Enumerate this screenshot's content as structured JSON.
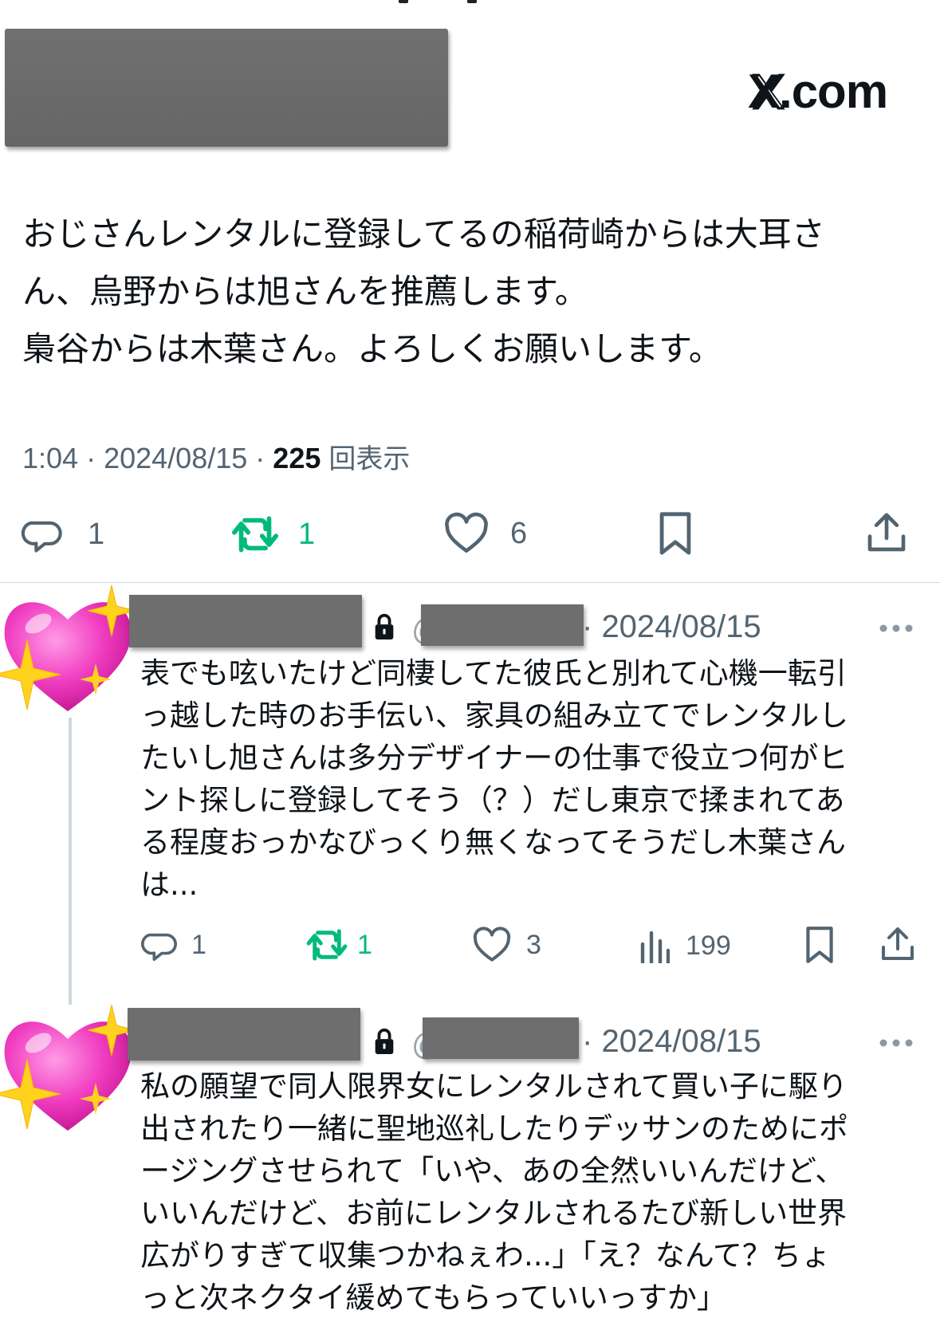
{
  "header": {
    "site_label": "X.com"
  },
  "tweet": {
    "text_lines": [
      "おじさんレンタルに登録してるの稲荷崎からは大耳さ",
      "ん、烏野からは旭さんを推薦します。",
      "梟谷からは木葉さん。よろしくお願いします。"
    ],
    "time": "1:04",
    "date": "2024/08/15",
    "views_count": "225",
    "views_label": "回表示",
    "replies": "1",
    "reposts": "1",
    "likes": "6"
  },
  "replies": [
    {
      "date": "2024/08/15",
      "text_lines": [
        "表でも呟いたけど同棲してた彼氏と別れて心機一転引",
        "っ越した時のお手伝い、家具の組み立てでレンタルし",
        "たいし旭さんは多分デザイナーの仕事で役立つ何がヒ",
        "ント探しに登録してそう（？）だし東京で揉まれてあ",
        "る程度おっかなびっくり無くなってそうだし木葉さん",
        "は..."
      ],
      "replies": "1",
      "reposts": "1",
      "likes": "3",
      "views": "199"
    },
    {
      "date": "2024/08/15",
      "text_lines": [
        "私の願望で同人限界女にレンタルされて買い子に駆り",
        "出されたり一緒に聖地巡礼したりデッサンのためにポ",
        "ージングさせられて「いや、あの全然いいんだけど、",
        "いいんだけど、お前にレンタルされるたび新しい世界",
        "広がりすぎて収集つかねぇわ...」「え？なんて？ちょ",
        "っと次ネクタイ緩めてもらっていいっすか」"
      ]
    }
  ],
  "icons": {
    "reply": "reply-bubble-icon",
    "repost": "repost-icon",
    "like": "heart-outline-icon",
    "bookmark": "bookmark-icon",
    "share": "share-icon",
    "views": "analytics-bars-icon",
    "lock": "lock-icon",
    "more": "more-dots-icon",
    "avatar": "sparkling-heart-emoji"
  },
  "colors": {
    "text": "#0f1419",
    "secondary": "#536471",
    "repost_green": "#00ba7c",
    "divider": "#cfd9de",
    "redaction": "#6e6e6e"
  }
}
